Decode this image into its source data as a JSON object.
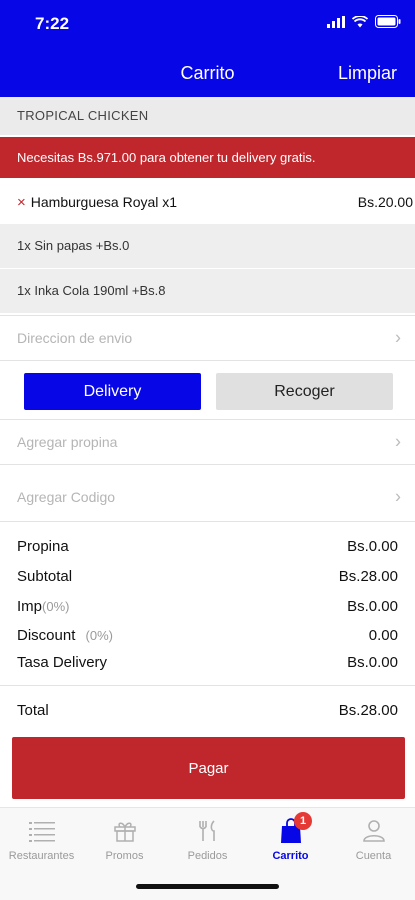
{
  "status_bar": {
    "time": "7:22"
  },
  "nav": {
    "title": "Carrito",
    "action": "Limpiar"
  },
  "restaurant": {
    "name": "TROPICAL CHICKEN"
  },
  "alert": {
    "text": "Necesitas Bs.971.00 para obtener tu delivery gratis."
  },
  "cart": {
    "item": {
      "remove_glyph": "×",
      "name": "Hamburguesa Royal x1",
      "price": "Bs.20.00"
    },
    "options": [
      "1x Sin papas +Bs.0",
      "1x Inka Cola 190ml +Bs.8"
    ]
  },
  "address": {
    "placeholder": "Direccion de envio"
  },
  "shipping": {
    "delivery_label": "Delivery",
    "pickup_label": "Recoger",
    "selected": "Delivery"
  },
  "tip": {
    "placeholder": "Agregar propina"
  },
  "code": {
    "placeholder": "Agregar Codigo"
  },
  "summary": {
    "propina": {
      "label": "Propina",
      "value": "Bs.0.00"
    },
    "subtotal": {
      "label": "Subtotal",
      "value": "Bs.28.00"
    },
    "imp": {
      "label": "Imp",
      "pct": "(0%)",
      "value": "Bs.0.00"
    },
    "discount": {
      "label": "Discount",
      "pct": "(0%)",
      "value": "0.00"
    },
    "tasa": {
      "label": "Tasa Delivery",
      "value": "Bs.0.00"
    },
    "total": {
      "label": "Total",
      "value": "Bs.28.00"
    }
  },
  "pay": {
    "label": "Pagar"
  },
  "tabs": [
    {
      "label": "Restaurantes",
      "icon": "list-icon"
    },
    {
      "label": "Promos",
      "icon": "gift-icon"
    },
    {
      "label": "Pedidos",
      "icon": "fork-knife-icon"
    },
    {
      "label": "Carrito",
      "icon": "bag-icon",
      "badge": "1"
    },
    {
      "label": "Cuenta",
      "icon": "user-icon"
    }
  ],
  "colors": {
    "brand_blue": "#0606e6",
    "accent_red": "#c0272d"
  }
}
